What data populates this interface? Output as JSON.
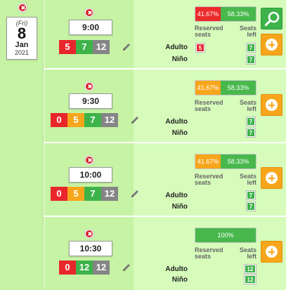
{
  "date": {
    "weekday": "(Fri)",
    "day": "8",
    "month": "Jan",
    "year": "2021"
  },
  "labels": {
    "reserved": "Reserved seats",
    "reserved_l1": "Reserved",
    "reserved_l2": "seats",
    "left_l1": "Seats",
    "left_l2": "left"
  },
  "colors": {
    "red": "#e9262b",
    "orange": "#f7a61c",
    "green": "#3db34a",
    "gray": "#858585",
    "panel_left": "#c6f3a4",
    "panel_right": "#d6fbbb"
  },
  "icons": {
    "delete": "close-circle-icon",
    "edit": "pencil-icon",
    "search": "search-icon",
    "add": "plus-circle-icon"
  },
  "slots": [
    {
      "time": "9:00",
      "counts": [
        "5",
        "7",
        "12"
      ],
      "bar": [
        {
          "label": "41.67%",
          "value": 41.67,
          "color": "red"
        },
        {
          "label": "58.33%",
          "value": 58.33,
          "color": "green"
        }
      ],
      "passengers": [
        {
          "name": "Adulto",
          "reserved": "5",
          "left": "7"
        },
        {
          "name": "Niño",
          "reserved": "",
          "left": "7"
        }
      ]
    },
    {
      "time": "9:30",
      "counts": [
        "0",
        "5",
        "7",
        "12"
      ],
      "bar": [
        {
          "label": "41.67%",
          "value": 41.67,
          "color": "orange"
        },
        {
          "label": "58.33%",
          "value": 58.33,
          "color": "green"
        }
      ],
      "passengers": [
        {
          "name": "Adulto",
          "reserved": "",
          "left": "7"
        },
        {
          "name": "Niño",
          "reserved": "",
          "left": "7"
        }
      ]
    },
    {
      "time": "10:00",
      "counts": [
        "0",
        "5",
        "7",
        "12"
      ],
      "bar": [
        {
          "label": "41.67%",
          "value": 41.67,
          "color": "orange"
        },
        {
          "label": "58.33%",
          "value": 58.33,
          "color": "green"
        }
      ],
      "passengers": [
        {
          "name": "Adulto",
          "reserved": "",
          "left": "7"
        },
        {
          "name": "Niño",
          "reserved": "",
          "left": "7"
        }
      ]
    },
    {
      "time": "10:30",
      "counts": [
        "0",
        "12",
        "12"
      ],
      "bar": [
        {
          "label": "100%",
          "value": 100,
          "color": "green"
        }
      ],
      "passengers": [
        {
          "name": "Adulto",
          "reserved": "",
          "left": "12"
        },
        {
          "name": "Niño",
          "reserved": "",
          "left": "12"
        }
      ]
    }
  ]
}
